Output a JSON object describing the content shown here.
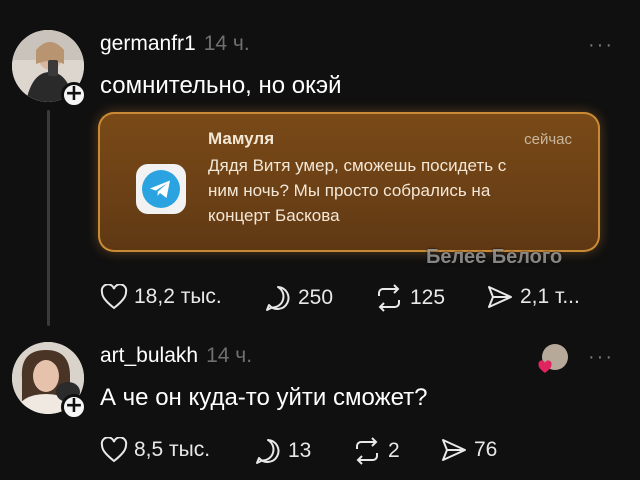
{
  "post": {
    "username": "germanfr1",
    "time": "14 ч.",
    "text": "сомнительно, но окэй",
    "more": "···",
    "notification": {
      "sender": "Мамуля",
      "time": "сейчас",
      "message": "Дядя Витя умер, сможешь посидеть с ним ночь? Мы просто собрались на концерт Баскова",
      "app_icon": "telegram-icon"
    },
    "watermark": "Белее Белого",
    "actions": {
      "likes": "18,2 тыс.",
      "comments": "250",
      "reposts": "125",
      "shares": "2,1 т..."
    }
  },
  "reply": {
    "username": "art_bulakh",
    "time": "14 ч.",
    "text": "А че он куда-то уйти сможет?",
    "more": "···",
    "actions": {
      "likes": "8,5 тыс.",
      "comments": "13",
      "reposts": "2",
      "shares": "76"
    }
  },
  "colors": {
    "background": "#101010",
    "notification_bg": "#6b4016",
    "notification_border": "#c98a36",
    "telegram_blue": "#2aa3e0",
    "like_badge": "#e0245e"
  }
}
